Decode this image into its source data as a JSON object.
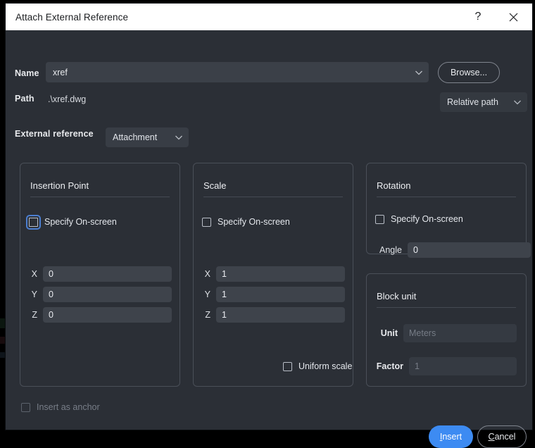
{
  "titlebar": {
    "title": "Attach External Reference",
    "help_label": "?",
    "close_icon": "close-icon"
  },
  "form": {
    "name_label": "Name",
    "name_value": "xref",
    "browse_label": "Browse...",
    "path_label": "Path",
    "path_value": ".\\xref.dwg",
    "path_type_value": "Relative path",
    "extref_label": "External reference",
    "extref_value": "Attachment"
  },
  "insertion_point": {
    "title": "Insertion Point",
    "specify_label": "Specify On-screen",
    "specify_checked": false,
    "fields": [
      {
        "label": "X",
        "value": "0"
      },
      {
        "label": "Y",
        "value": "0"
      },
      {
        "label": "Z",
        "value": "0"
      }
    ]
  },
  "scale": {
    "title": "Scale",
    "specify_label": "Specify On-screen",
    "specify_checked": false,
    "fields": [
      {
        "label": "X",
        "value": "1"
      },
      {
        "label": "Y",
        "value": "1"
      },
      {
        "label": "Z",
        "value": "1"
      }
    ],
    "uniform_label": "Uniform scale",
    "uniform_checked": false
  },
  "rotation": {
    "title": "Rotation",
    "specify_label": "Specify On-screen",
    "specify_checked": false,
    "angle_label": "Angle",
    "angle_value": "0"
  },
  "block_unit": {
    "title": "Block unit",
    "unit_label": "Unit",
    "unit_value": "Meters",
    "factor_label": "Factor",
    "factor_value": "1"
  },
  "footer": {
    "anchor_label": "Insert as anchor",
    "anchor_checked": false,
    "insert_label_mnemonic": "I",
    "insert_label_rest": "nsert",
    "cancel_label_pre": "",
    "cancel_label_mnemonic": "C",
    "cancel_label_rest": "ancel"
  },
  "colors": {
    "accent": "#3d8bf2",
    "dialog_bg": "#2b2f36",
    "titlebar_bg": "#ffffff",
    "field_bg": "#3e434b",
    "focus_ring": "#4c7fd1"
  }
}
